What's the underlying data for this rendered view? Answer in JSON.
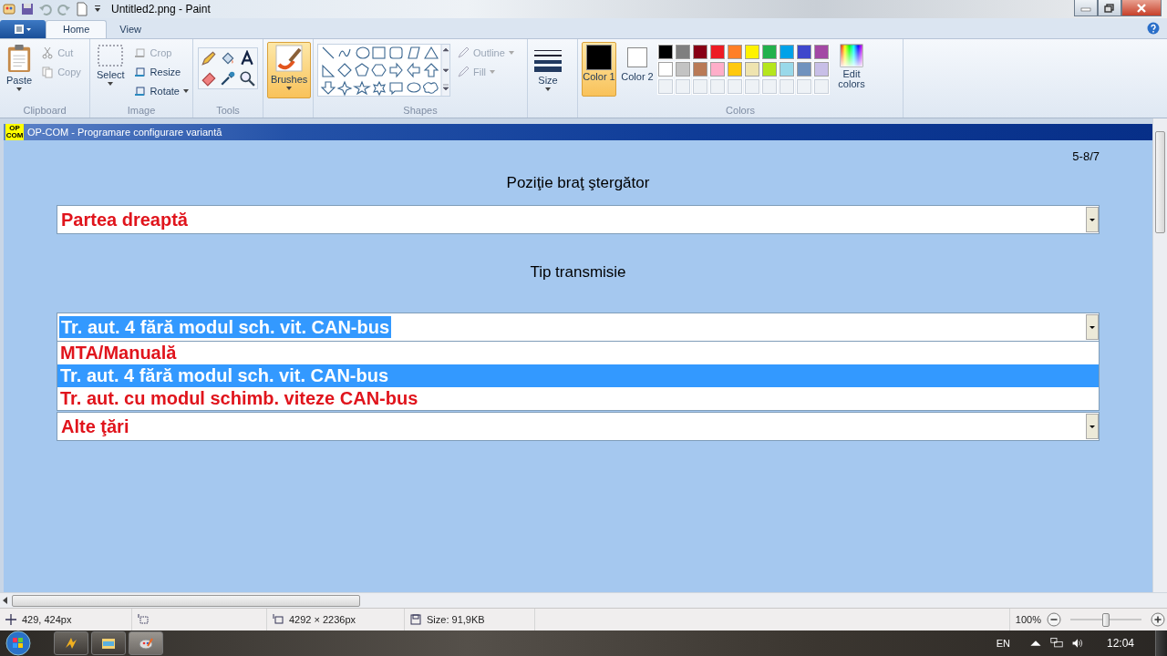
{
  "window": {
    "title": "Untitled2.png - Paint"
  },
  "tabs": [
    {
      "label": "Home",
      "selected": true
    },
    {
      "label": "View",
      "selected": false
    }
  ],
  "clipboard": {
    "label": "Clipboard",
    "paste": "Paste",
    "small": [
      {
        "label": "Cut",
        "disabled": true
      },
      {
        "label": "Copy",
        "disabled": true
      }
    ]
  },
  "image_group": {
    "label": "Image",
    "select": "Select",
    "small": [
      {
        "label": "Crop",
        "disabled": true
      },
      {
        "label": "Resize",
        "disabled": false
      },
      {
        "label": "Rotate",
        "disabled": false
      }
    ]
  },
  "tools": {
    "label": "Tools"
  },
  "brushes": {
    "label": "Brushes",
    "selected": true
  },
  "shapes": {
    "label": "Shapes",
    "options": [
      {
        "label": "Outline",
        "disabled": true
      },
      {
        "label": "Fill",
        "disabled": true
      }
    ]
  },
  "size": {
    "label": "Size"
  },
  "colors": {
    "label": "Colors",
    "color1": {
      "label": "Color 1",
      "color": "#000000",
      "selected": true
    },
    "color2": {
      "label": "Color 2",
      "color": "#ffffff",
      "selected": false
    },
    "palette": [
      {
        "color": "#000000"
      },
      {
        "color": "#7f7f7f"
      },
      {
        "color": "#880015"
      },
      {
        "color": "#ed1c24"
      },
      {
        "color": "#ff7f27"
      },
      {
        "color": "#fff200"
      },
      {
        "color": "#22b14c"
      },
      {
        "color": "#00a2e8"
      },
      {
        "color": "#3f48cc"
      },
      {
        "color": "#a349a4"
      },
      {
        "color": "#ffffff"
      },
      {
        "color": "#c3c3c3"
      },
      {
        "color": "#b97a57"
      },
      {
        "color": "#ffaec9"
      },
      {
        "color": "#ffc90e"
      },
      {
        "color": "#efe4b0"
      },
      {
        "color": "#b5e61d"
      },
      {
        "color": "#99d9ea"
      },
      {
        "color": "#7092be"
      },
      {
        "color": "#c8bfe7"
      }
    ],
    "edit": "Edit colors"
  },
  "picture": {
    "title": "OP-COM - Programare configurare variantă",
    "logo": [
      "OP",
      "COM"
    ],
    "page": "5-8/7",
    "sections": [
      {
        "label": "Poziţie braţ ştergător",
        "value": "Partea dreaptă",
        "highlighted": false
      },
      {
        "label": "Tip transmisie",
        "value": "Tr. aut. 4 fără modul sch. vit. CAN-bus",
        "highlighted": true,
        "options": [
          {
            "label": "MTA/Manuală",
            "selected": false
          },
          {
            "label": "Tr. aut. 4 fără modul sch. vit. CAN-bus",
            "selected": true
          },
          {
            "label": "Tr. aut. cu modul schimb. viteze CAN-bus",
            "selected": false
          }
        ]
      },
      {
        "value": "Alte ţări",
        "highlighted": false
      }
    ]
  },
  "status_bar": {
    "cursor": "429, 424px",
    "dimensions": "4292 × 2236px",
    "file_size": "Size: 91,9KB",
    "zoom": "100%",
    "zoom_level": {
      "level": 0.5
    }
  },
  "taskbar": {
    "language": "EN",
    "time": "12:04"
  }
}
